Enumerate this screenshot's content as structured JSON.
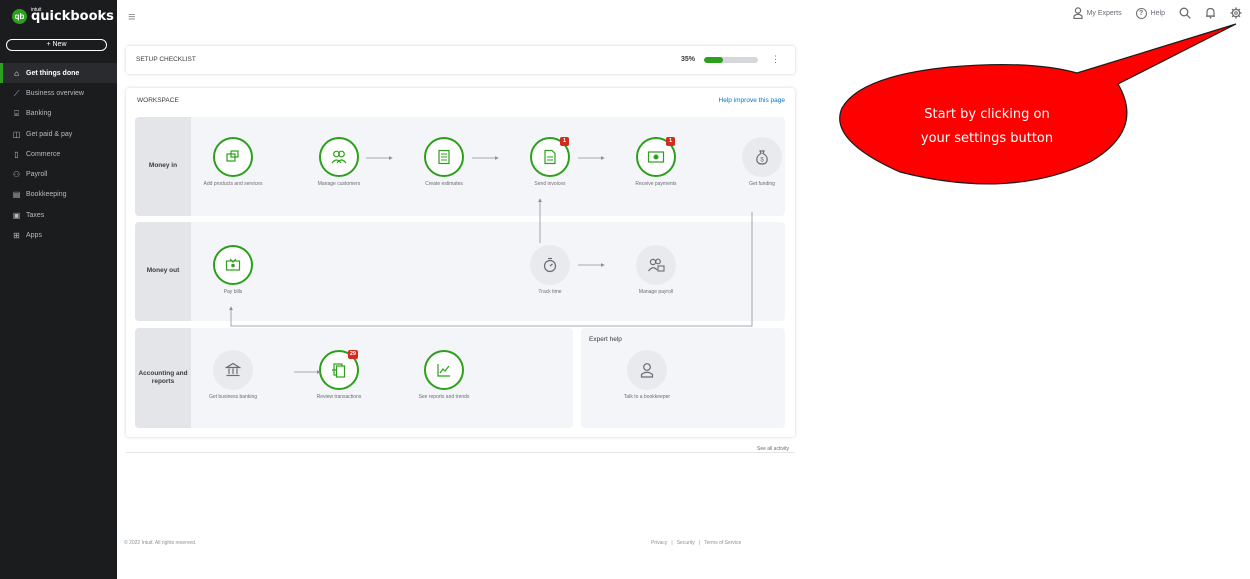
{
  "app": {
    "brand": "quickbooks",
    "brand_prefix": "intuit",
    "logo_mark": "qb"
  },
  "sidebar": {
    "new_label": "+ New",
    "items": [
      {
        "label": "Get things done",
        "icon": "house-icon",
        "glyph": "⌂",
        "active": true
      },
      {
        "label": "Business overview",
        "icon": "chart-line-icon",
        "glyph": "⟋"
      },
      {
        "label": "Banking",
        "icon": "bank-icon",
        "glyph": "⌸"
      },
      {
        "label": "Get paid & pay",
        "icon": "money-icon",
        "glyph": "◫"
      },
      {
        "label": "Commerce",
        "icon": "commerce-icon",
        "glyph": "▯"
      },
      {
        "label": "Payroll",
        "icon": "people-icon",
        "glyph": "⚇"
      },
      {
        "label": "Bookkeeping",
        "icon": "ledger-icon",
        "glyph": "▤"
      },
      {
        "label": "Taxes",
        "icon": "tax-icon",
        "glyph": "▣"
      },
      {
        "label": "Apps",
        "icon": "apps-grid-icon",
        "glyph": "⊞"
      }
    ]
  },
  "topbar": {
    "my_experts": "My Experts",
    "help": "Help"
  },
  "checklist": {
    "title": "SETUP CHECKLIST",
    "progress_label": "35%",
    "progress": 0.35
  },
  "workspace": {
    "title": "WORKSPACE",
    "help_link": "Help improve this page",
    "money_in": {
      "label": "Money in",
      "nodes": [
        {
          "label": "Add products and services",
          "icon": "product-box-icon"
        },
        {
          "label": "Manage customers",
          "icon": "customers-icon"
        },
        {
          "label": "Create estimates",
          "icon": "estimate-icon"
        },
        {
          "label": "Send invoices",
          "icon": "invoice-icon",
          "badge": "1"
        },
        {
          "label": "Receive payments",
          "icon": "payment-icon",
          "badge": "1"
        },
        {
          "label": "Get funding",
          "icon": "money-bag-icon"
        }
      ]
    },
    "money_out": {
      "label": "Money out",
      "nodes": [
        {
          "label": "Pay bills",
          "icon": "bill-icon"
        },
        {
          "label": "Track time",
          "icon": "stopwatch-icon"
        },
        {
          "label": "Manage payroll",
          "icon": "payroll-icon"
        }
      ]
    },
    "accounting": {
      "label": "Accounting and reports",
      "nodes": [
        {
          "label": "Get business banking",
          "icon": "bank-icon"
        },
        {
          "label": "Review transactions",
          "icon": "transactions-icon",
          "badge": "29"
        },
        {
          "label": "See reports and trends",
          "icon": "trend-icon"
        }
      ]
    },
    "expert": {
      "title": "Expert help",
      "node_label": "Talk to a bookkeeper"
    }
  },
  "see_all": "See all activity",
  "footer": {
    "copyright": "© 2022 Intuit. All rights reserved.",
    "links": [
      "Privacy",
      "|",
      "Security",
      "|",
      "Terms of Service"
    ]
  },
  "callout": {
    "line1": "Start by clicking on",
    "line2": "your settings button",
    "color": "#ff0000"
  },
  "colors": {
    "accent": "#2ca01c",
    "badge": "#d52b1e",
    "sidebar": "#1b1c1e",
    "link": "#0077c5"
  }
}
